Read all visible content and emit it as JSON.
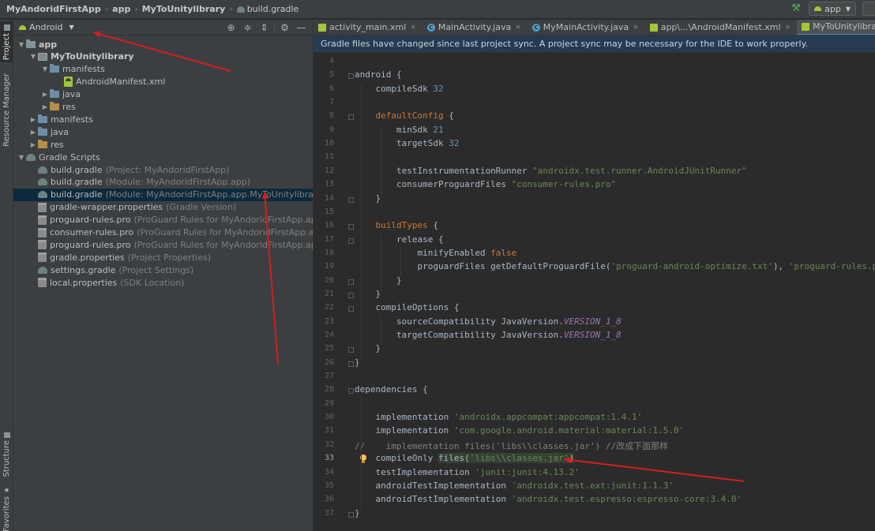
{
  "breadcrumb": {
    "project": "MyAndoridFirstApp",
    "module": "app",
    "submodule": "MyToUnitylibrary",
    "file": "build.gradle"
  },
  "toolbar": {
    "run_config": "app",
    "build_icon": "hammer-icon"
  },
  "side_tabs": [
    "Project",
    "Resource Manager",
    "Structure",
    "Favorites"
  ],
  "project_panel": {
    "view_mode": "Android",
    "tools": [
      "target-icon",
      "collapse-all-icon",
      "expand-all-icon",
      "gear-icon",
      "minimize-icon"
    ],
    "tree": [
      {
        "label": "app",
        "hint": "",
        "icon": "folder-icon",
        "depth": 0,
        "arrow": "down",
        "bold": true
      },
      {
        "label": "MyToUnitylibrary",
        "hint": "",
        "icon": "module-icon",
        "depth": 1,
        "arrow": "down",
        "bold": true
      },
      {
        "label": "manifests",
        "hint": "",
        "icon": "folder-icon",
        "depth": 2,
        "arrow": "down",
        "bold": false
      },
      {
        "label": "AndroidManifest.xml",
        "hint": "",
        "icon": "xml-file-icon",
        "depth": 4,
        "arrow": "none",
        "bold": false
      },
      {
        "label": "java",
        "hint": "",
        "icon": "folder-icon",
        "depth": 2,
        "arrow": "right",
        "bold": false
      },
      {
        "label": "res",
        "hint": "",
        "icon": "res-folder-icon",
        "depth": 2,
        "arrow": "right",
        "bold": false
      },
      {
        "label": "manifests",
        "hint": "",
        "icon": "folder-icon",
        "depth": 1,
        "arrow": "right",
        "bold": false
      },
      {
        "label": "java",
        "hint": "",
        "icon": "folder-icon",
        "depth": 1,
        "arrow": "right",
        "bold": false
      },
      {
        "label": "res",
        "hint": "",
        "icon": "res-folder-icon",
        "depth": 1,
        "arrow": "right",
        "bold": false
      },
      {
        "label": "Gradle Scripts",
        "hint": "",
        "icon": "gradle-icon",
        "depth": 0,
        "arrow": "down",
        "bold": false
      },
      {
        "label": "build.gradle",
        "hint": "(Project: MyAndoridFirstApp)",
        "icon": "gradle-icon",
        "depth": 1,
        "arrow": "none",
        "bold": false
      },
      {
        "label": "build.gradle",
        "hint": "(Module: MyAndoridFirstApp.app)",
        "icon": "gradle-icon",
        "depth": 1,
        "arrow": "none",
        "bold": false
      },
      {
        "label": "build.gradle",
        "hint": "(Module: MyAndoridFirstApp.app.MyToUnitylibrary)",
        "icon": "gradle-icon",
        "depth": 1,
        "arrow": "none",
        "bold": false,
        "selected": true
      },
      {
        "label": "gradle-wrapper.properties",
        "hint": "(Gradle Version)",
        "icon": "properties-icon",
        "depth": 1,
        "arrow": "none",
        "bold": false
      },
      {
        "label": "proguard-rules.pro",
        "hint": "(ProGuard Rules for MyAndoridFirstApp.app)",
        "icon": "properties-icon",
        "depth": 1,
        "arrow": "none",
        "bold": false
      },
      {
        "label": "consumer-rules.pro",
        "hint": "(ProGuard Rules for MyAndoridFirstApp.app.MyToUnitylibrary)",
        "icon": "properties-icon",
        "depth": 1,
        "arrow": "none",
        "bold": false
      },
      {
        "label": "proguard-rules.pro",
        "hint": "(ProGuard Rules for MyAndoridFirstApp.app.MyToUnitylibrary)",
        "icon": "properties-icon",
        "depth": 1,
        "arrow": "none",
        "bold": false
      },
      {
        "label": "gradle.properties",
        "hint": "(Project Properties)",
        "icon": "properties-icon",
        "depth": 1,
        "arrow": "none",
        "bold": false
      },
      {
        "label": "settings.gradle",
        "hint": "(Project Settings)",
        "icon": "gradle-icon",
        "depth": 1,
        "arrow": "none",
        "bold": false
      },
      {
        "label": "local.properties",
        "hint": "(SDK Location)",
        "icon": "properties-icon",
        "depth": 1,
        "arrow": "none",
        "bold": false
      }
    ]
  },
  "editor": {
    "tabs": [
      {
        "label": "activity_main.xml",
        "icon": "xml",
        "active": false
      },
      {
        "label": "MainActivity.java",
        "icon": "class",
        "active": false
      },
      {
        "label": "MyMainActivity.java",
        "icon": "class",
        "active": false
      },
      {
        "label": "app\\...\\AndroidManifest.xml",
        "icon": "xml",
        "active": false
      },
      {
        "label": "MyToUnitylibrary\\...\\AndroidManifest.xml",
        "icon": "xml",
        "active": true
      }
    ],
    "notice": "Gradle files have changed since last project sync. A project sync may be necessary for the IDE to work properly.",
    "current_line": 33,
    "lines": [
      {
        "n": 4,
        "tokens": []
      },
      {
        "n": 5,
        "tokens": [
          [
            "",
            "android {"
          ]
        ]
      },
      {
        "n": 6,
        "tokens": [
          [
            "",
            "    compileSdk "
          ],
          [
            "num",
            "32"
          ]
        ]
      },
      {
        "n": 7,
        "tokens": []
      },
      {
        "n": 8,
        "tokens": [
          [
            "kw",
            "    defaultConfig"
          ],
          [
            "",
            " {"
          ]
        ]
      },
      {
        "n": 9,
        "tokens": [
          [
            "",
            "        minSdk "
          ],
          [
            "num",
            "21"
          ]
        ]
      },
      {
        "n": 10,
        "tokens": [
          [
            "",
            "        targetSdk "
          ],
          [
            "num",
            "32"
          ]
        ]
      },
      {
        "n": 11,
        "tokens": []
      },
      {
        "n": 12,
        "tokens": [
          [
            "",
            "        testInstrumentationRunner "
          ],
          [
            "str",
            "\"androidx.test.runner.AndroidJUnitRunner\""
          ]
        ]
      },
      {
        "n": 13,
        "tokens": [
          [
            "",
            "        consumerProguardFiles "
          ],
          [
            "str",
            "\"consumer-rules.pro\""
          ]
        ]
      },
      {
        "n": 14,
        "tokens": [
          [
            "",
            "    }"
          ]
        ]
      },
      {
        "n": 15,
        "tokens": []
      },
      {
        "n": 16,
        "tokens": [
          [
            "kw",
            "    buildTypes"
          ],
          [
            "",
            " {"
          ]
        ]
      },
      {
        "n": 17,
        "tokens": [
          [
            "",
            "        release {"
          ]
        ]
      },
      {
        "n": 18,
        "tokens": [
          [
            "",
            "            minifyEnabled "
          ],
          [
            "kw",
            "false"
          ]
        ]
      },
      {
        "n": 19,
        "tokens": [
          [
            "",
            "            proguardFiles getDefaultProguardFile("
          ],
          [
            "str",
            "'proguard-android-optimize.txt'"
          ],
          [
            "",
            "), "
          ],
          [
            "str",
            "'proguard-rules.pro'"
          ]
        ]
      },
      {
        "n": 20,
        "tokens": [
          [
            "",
            "        }"
          ]
        ]
      },
      {
        "n": 21,
        "tokens": [
          [
            "",
            "    }"
          ]
        ]
      },
      {
        "n": 22,
        "tokens": [
          [
            "",
            "    compileOptions {"
          ]
        ]
      },
      {
        "n": 23,
        "tokens": [
          [
            "",
            "        sourceCompatibility JavaVersion."
          ],
          [
            "const",
            "VERSION_1_8"
          ]
        ]
      },
      {
        "n": 24,
        "tokens": [
          [
            "",
            "        targetCompatibility JavaVersion."
          ],
          [
            "const",
            "VERSION_1_8"
          ]
        ]
      },
      {
        "n": 25,
        "tokens": [
          [
            "",
            "    }"
          ]
        ]
      },
      {
        "n": 26,
        "tokens": [
          [
            "",
            "}"
          ]
        ]
      },
      {
        "n": 27,
        "tokens": []
      },
      {
        "n": 28,
        "tokens": [
          [
            "",
            "dependencies {"
          ]
        ]
      },
      {
        "n": 29,
        "tokens": []
      },
      {
        "n": 30,
        "tokens": [
          [
            "",
            "    implementation "
          ],
          [
            "str",
            "'androidx.appcompat:appcompat:1.4.1'"
          ]
        ]
      },
      {
        "n": 31,
        "tokens": [
          [
            "",
            "    implementation "
          ],
          [
            "str",
            "'com.google.android.material:material:1.5.0'"
          ]
        ]
      },
      {
        "n": 32,
        "tokens": [
          [
            "cm",
            "//    implementation files('libs\\\\classes.jar') //改成下面那样"
          ]
        ]
      },
      {
        "n": 33,
        "tokens": [
          [
            "",
            "    compileOnly "
          ],
          [
            "hl",
            "files("
          ],
          [
            "hlstr",
            "'libs\\\\classes.jar'"
          ],
          [
            "hl",
            ")"
          ]
        ]
      },
      {
        "n": 34,
        "tokens": [
          [
            "",
            "    testImplementation "
          ],
          [
            "str",
            "'junit:junit:4.13.2'"
          ]
        ]
      },
      {
        "n": 35,
        "tokens": [
          [
            "",
            "    androidTestImplementation "
          ],
          [
            "str",
            "'androidx.test.ext:junit:1.1.3'"
          ]
        ]
      },
      {
        "n": 36,
        "tokens": [
          [
            "",
            "    androidTestImplementation "
          ],
          [
            "str",
            "'androidx.test.espresso:espresso-core:3.4.0'"
          ]
        ]
      },
      {
        "n": 37,
        "tokens": [
          [
            "",
            "}"
          ]
        ]
      }
    ]
  },
  "colors": {
    "annotation_arrow": "#d21f1f",
    "selection": "#0d293e",
    "notice_bg": "#263b50"
  }
}
